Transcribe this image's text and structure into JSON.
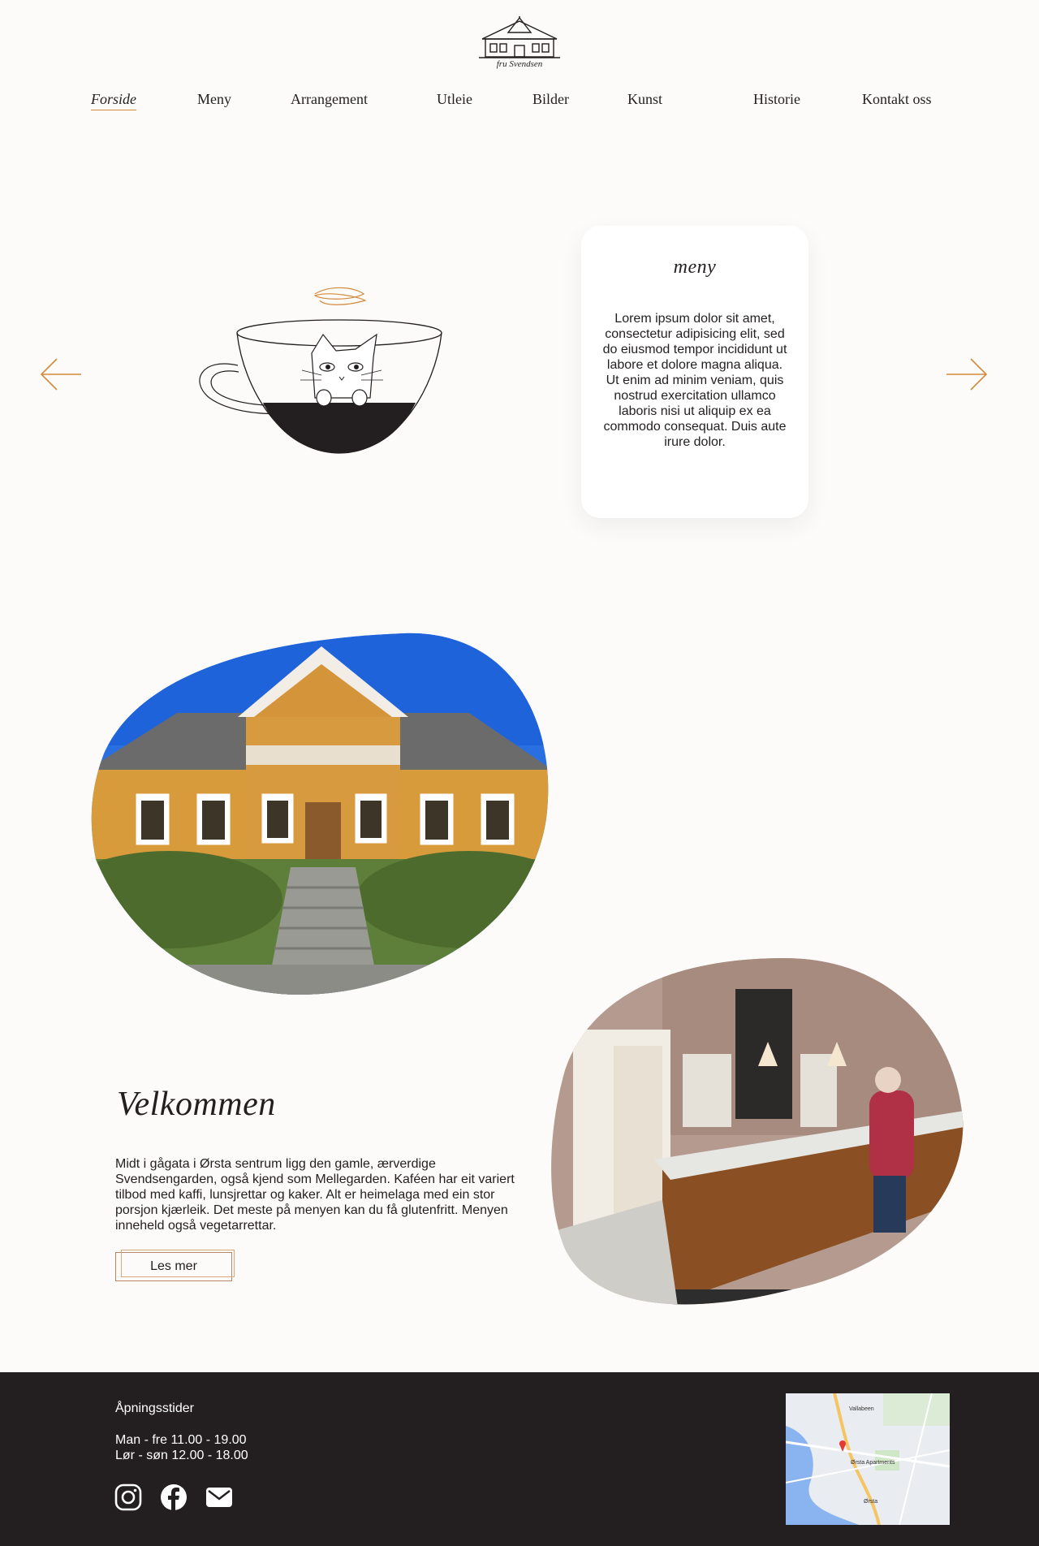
{
  "brand": {
    "logo_text": "fru Svendsen"
  },
  "nav": {
    "items": [
      {
        "label": "Forside",
        "active": true
      },
      {
        "label": "Meny",
        "active": false
      },
      {
        "label": "Arrangement",
        "active": false
      },
      {
        "label": "Utleie",
        "active": false
      },
      {
        "label": "Bilder",
        "active": false
      },
      {
        "label": "Kunst",
        "active": false
      },
      {
        "label": "Historie",
        "active": false
      },
      {
        "label": "Kontakt oss",
        "active": false
      }
    ]
  },
  "slider": {
    "prev_icon": "arrow-left-icon",
    "next_icon": "arrow-right-icon",
    "card_title": "meny",
    "card_text": "Lorem ipsum dolor sit amet, consectetur adipisicing elit, sed do eiusmod tempor incididunt ut labore et dolore magna aliqua. Ut enim ad minim veniam, quis nostrud exercitation ullamco laboris nisi ut aliquip ex ea commodo consequat. Duis aute irure dolor."
  },
  "welcome": {
    "title": "Velkommen",
    "text": "Midt i gågata i Ørsta sentrum ligg den gamle, ærverdige Svendsengarden, også kjend som Mellegarden. Kaféen har eit variert tilbod med kaffi, lunsjrettar og kaker. Alt er heimelaga med ein stor porsjon kjærleik. Det meste på menyen kan du få glutenfritt. Menyen inneheld også vegetarrettar.",
    "button_label": "Les mer"
  },
  "footer": {
    "hours_title": "Åpningsstider",
    "hours": [
      "Man - fre 11.00 - 19.00",
      "Lør - søn 12.00 - 18.00"
    ],
    "socials": [
      "instagram-icon",
      "facebook-icon",
      "mail-icon"
    ],
    "map_labels": [
      "Vallabeen",
      "Ørsta",
      "Ørsta Apartments"
    ]
  },
  "colors": {
    "accent": "#d38a3c",
    "background": "#fcfbf9",
    "footer": "#231f20",
    "card": "#ffffff"
  }
}
